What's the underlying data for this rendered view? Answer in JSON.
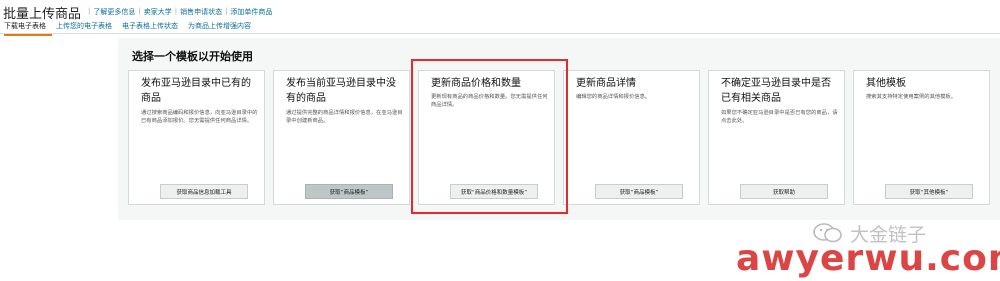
{
  "header": {
    "title": "批量上传商品",
    "links": [
      "了解更多信息",
      "卖家大学",
      "销售申请状态",
      "添加单件商品"
    ]
  },
  "tabs": [
    {
      "label": "下载电子表格",
      "active": true
    },
    {
      "label": "上传您的电子表格",
      "active": false
    },
    {
      "label": "电子表格上传状态",
      "active": false
    },
    {
      "label": "为商品上传增强内容",
      "active": false
    }
  ],
  "main": {
    "heading": "选择一个模板以开始使用",
    "cards": [
      {
        "title": "发布亚马逊目录中已有的商品",
        "description": "通过搜索商品编码和报价信息，向亚马逊目录中的已有商品添加报价。您无需提供任何商品详情。",
        "button": "获取商品信息加载工具",
        "button_dark": false
      },
      {
        "title": "发布当前亚马逊目录中没有的商品",
        "description": "通过提供完整的商品详情和报价信息，在亚马逊目录中创建新商品。",
        "button": "获取“商品模板”",
        "button_dark": true
      },
      {
        "title": "更新商品价格和数量",
        "description": "更新现有商品的商品价格和数量。您无需提供任何商品详情。",
        "button": "获取“商品价格和数量模板”",
        "button_dark": false
      },
      {
        "title": "更新商品详情",
        "description": "编辑您的商品详情和报价信息。",
        "button": "获取“商品模板”",
        "button_dark": false
      },
      {
        "title": "不确定亚马逊目录中是否已有相关商品",
        "description": "如果您不确定亚马逊目录中是否已有您的商品，请点击此处。",
        "button": "获取帮助",
        "button_dark": false
      },
      {
        "title": "其他模板",
        "description": "搜索其支持特定使用案例的其他模板。",
        "button": "获取“其他模板”",
        "button_dark": false
      }
    ]
  },
  "watermark": {
    "text": "大金链子",
    "url": "awyerwu.com",
    "color": "#d51b1b"
  },
  "annotation": {
    "color": "#e32b2b"
  }
}
